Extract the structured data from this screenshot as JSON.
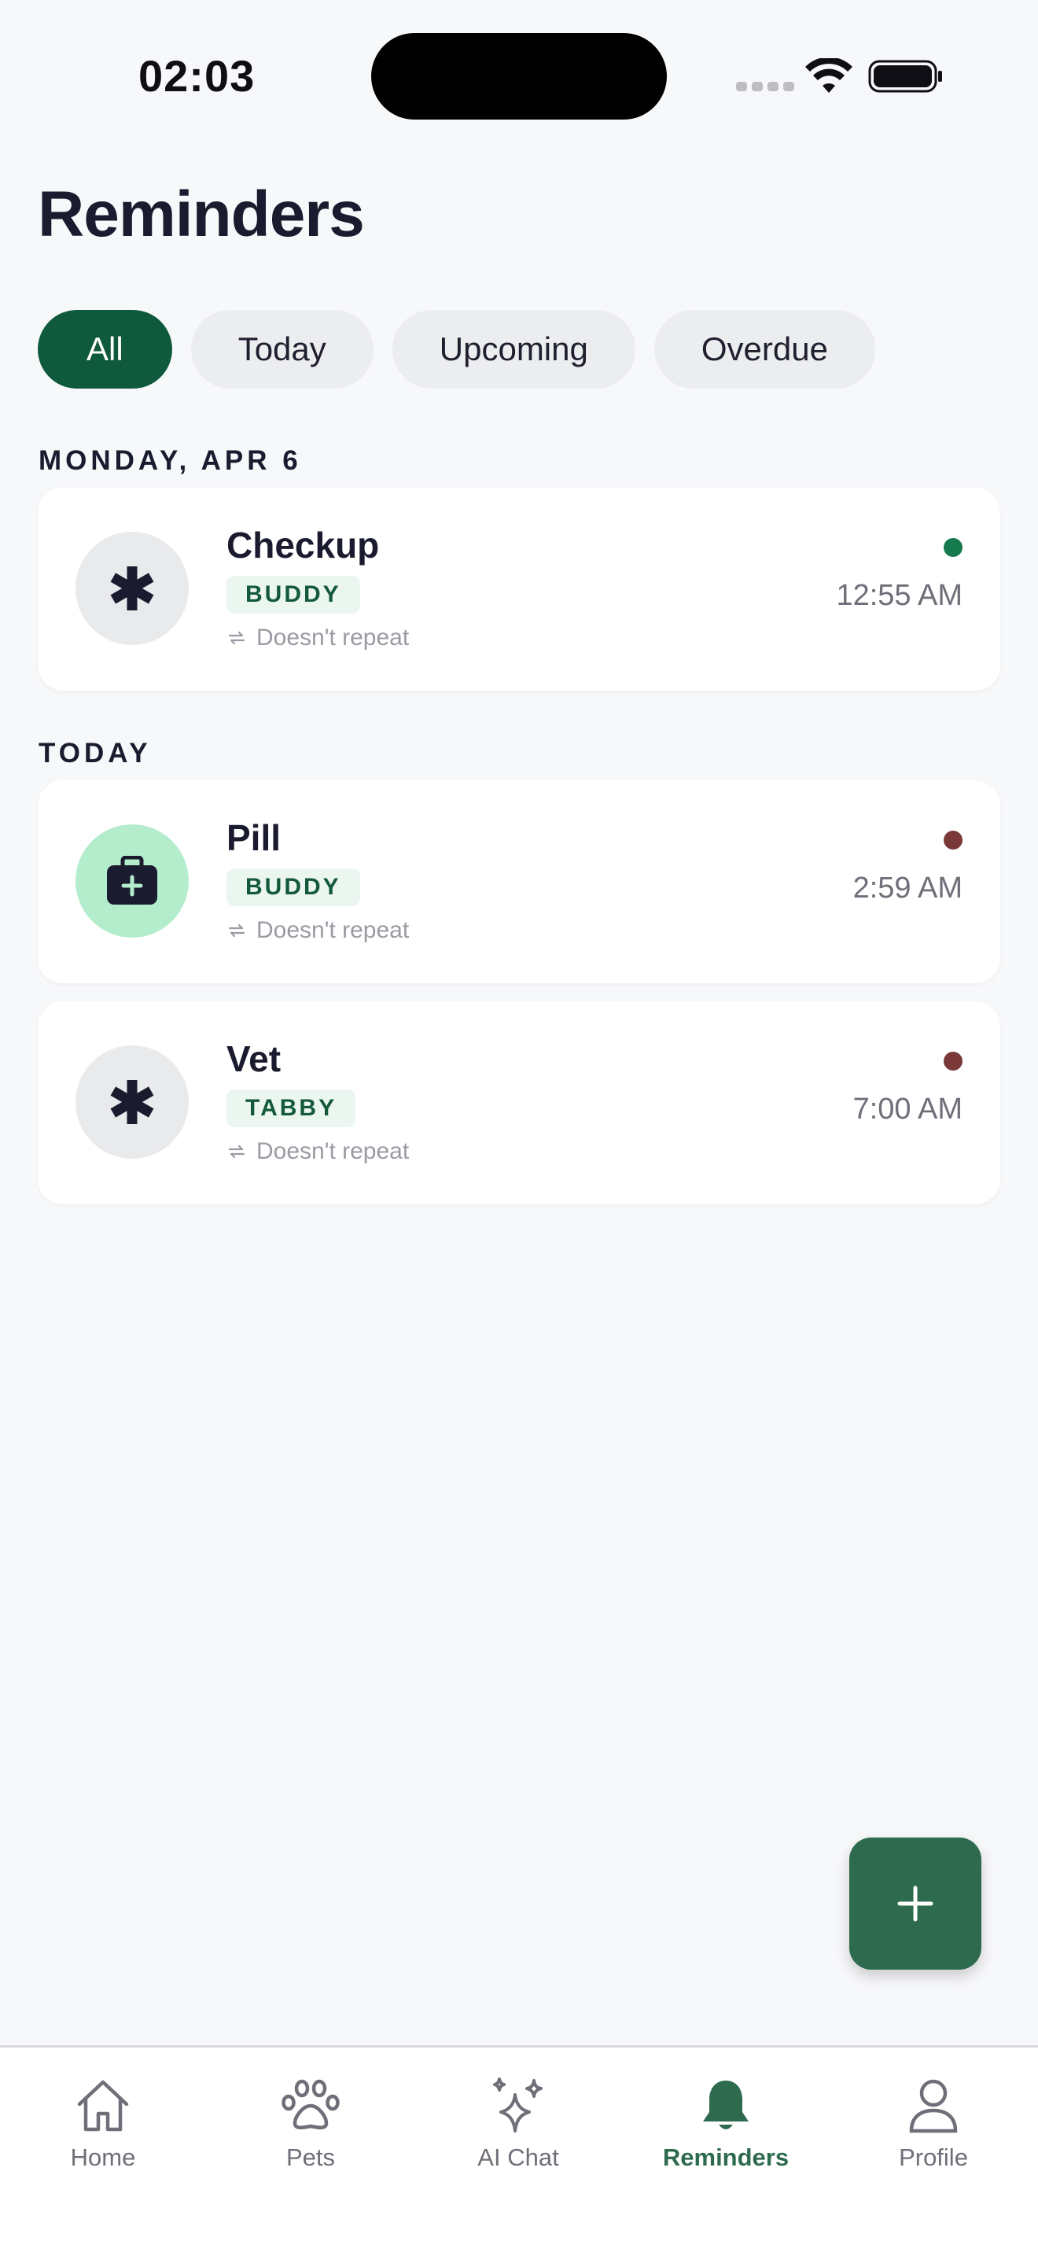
{
  "status_bar": {
    "time": "02:03"
  },
  "title": "Reminders",
  "filters": [
    {
      "label": "All",
      "active": true
    },
    {
      "label": "Today",
      "active": false
    },
    {
      "label": "Upcoming",
      "active": false
    },
    {
      "label": "Overdue",
      "active": false
    }
  ],
  "sections": [
    {
      "label": "MONDAY, APR 6",
      "items": [
        {
          "name": "Checkup",
          "pet": "BUDDY",
          "repeat": "Doesn't repeat",
          "time": "12:55 AM",
          "icon": "asterisk-icon",
          "status_color": "#157A4E"
        }
      ]
    },
    {
      "label": "TODAY",
      "items": [
        {
          "name": "Pill",
          "pet": "BUDDY",
          "repeat": "Doesn't repeat",
          "time": "2:59 AM",
          "icon": "medkit-icon",
          "status_color": "#7A3838"
        },
        {
          "name": "Vet",
          "pet": "TABBY",
          "repeat": "Doesn't repeat",
          "time": "7:00 AM",
          "icon": "asterisk-icon",
          "status_color": "#7A3838"
        }
      ]
    }
  ],
  "fab": {
    "icon": "plus-icon"
  },
  "tab_bar": {
    "tabs": [
      {
        "label": "Home",
        "icon": "home-icon",
        "active": false
      },
      {
        "label": "Pets",
        "icon": "paw-icon",
        "active": false
      },
      {
        "label": "AI Chat",
        "icon": "sparkles-icon",
        "active": false
      },
      {
        "label": "Reminders",
        "icon": "bell-icon",
        "active": true
      },
      {
        "label": "Profile",
        "icon": "user-icon",
        "active": false
      }
    ]
  },
  "colors": {
    "accent": "#0F5A3C",
    "fab": "#2E6B4E",
    "background": "#F7F8FA"
  }
}
